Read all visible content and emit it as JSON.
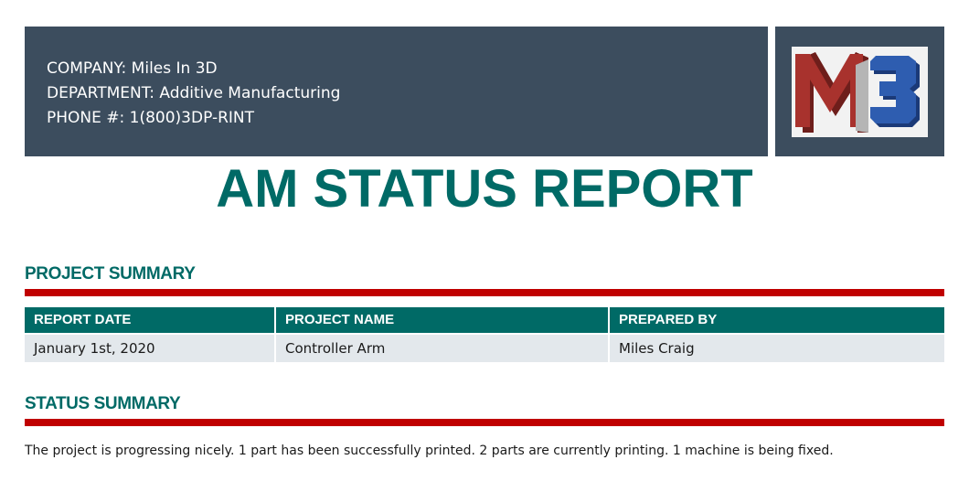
{
  "header": {
    "company_line": "COMPANY: Miles In 3D",
    "department_line": "DEPARTMENT: Additive Manufacturing",
    "phone_line": "PHONE #: 1(800)3DP-RINT"
  },
  "logo": {
    "icon": "mi3-letters-logo",
    "colors": {
      "m_red": "#a8322d",
      "m_shade": "#6e1e1b",
      "gray_bar": "#b5b5b5",
      "three_blue": "#2e5db0",
      "three_shade": "#1b3a78"
    }
  },
  "title": "AM STATUS REPORT",
  "project_summary": {
    "heading": "PROJECT SUMMARY",
    "columns": [
      "REPORT DATE",
      "PROJECT NAME",
      "PREPARED BY"
    ],
    "row": [
      "January 1st, 2020",
      "Controller Arm",
      "Miles Craig"
    ]
  },
  "status_summary": {
    "heading": "STATUS SUMMARY",
    "text": "The project is progressing nicely. 1 part has been successfully printed. 2 parts are currently printing. 1 machine is being fixed."
  },
  "colors": {
    "header_bg": "#3c4d5e",
    "accent_teal": "#006a66",
    "rule_red": "#c00000",
    "table_row_bg": "#e3e8ec"
  }
}
